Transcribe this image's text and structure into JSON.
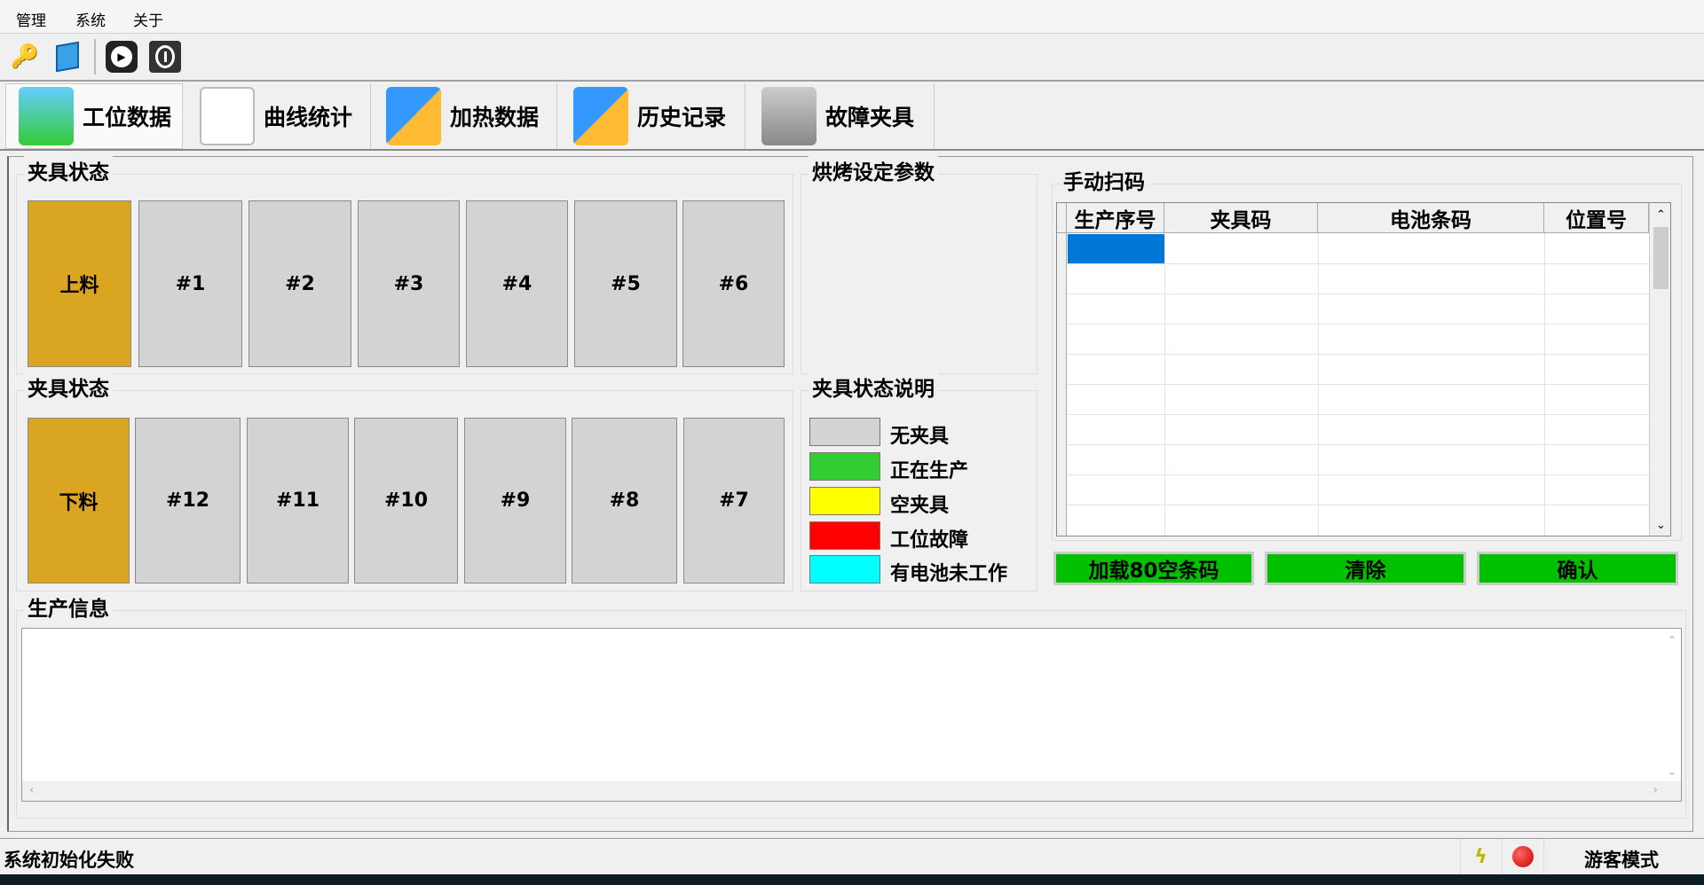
{
  "menu": [
    "管理",
    "系统",
    "关于"
  ],
  "toolbar": {
    "icons": [
      "key-icon",
      "monitor-icon",
      "play-icon",
      "power-icon"
    ]
  },
  "tabs": [
    {
      "label": "工位数据",
      "active": true
    },
    {
      "label": "曲线统计"
    },
    {
      "label": "加热数据"
    },
    {
      "label": "历史记录"
    },
    {
      "label": "故障夹具"
    }
  ],
  "upper_group": {
    "title": "夹具状态",
    "slots": [
      "上料",
      "#1",
      "#2",
      "#3",
      "#4",
      "#5",
      "#6"
    ]
  },
  "lower_group": {
    "title": "夹具状态",
    "slots": [
      "下料",
      "#12",
      "#11",
      "#10",
      "#9",
      "#8",
      "#7"
    ]
  },
  "bake_params": {
    "title": "烘烤设定参数"
  },
  "legend": {
    "title": "夹具状态说明",
    "items": [
      {
        "label": "无夹具",
        "color": "#d3d3d3"
      },
      {
        "label": "正在生产",
        "color": "#32cd32"
      },
      {
        "label": "空夹具",
        "color": "#ffff00"
      },
      {
        "label": "工位故障",
        "color": "#ff0000"
      },
      {
        "label": "有电池未工作",
        "color": "#00ffff"
      }
    ]
  },
  "scan": {
    "title": "手动扫码",
    "columns": [
      "生产序号",
      "夹具码",
      "电池条码",
      "位置号"
    ],
    "buttons": [
      "加载80空条码",
      "清除",
      "确认"
    ]
  },
  "production_info": {
    "title": "生产信息"
  },
  "status": {
    "message": "系统初始化失败",
    "mode": "游客模式"
  },
  "colors": {
    "load_slot": "#daa520",
    "empty_slot": "#d3d3d3",
    "button_green": "#00c000",
    "selection": "#0078d7"
  }
}
